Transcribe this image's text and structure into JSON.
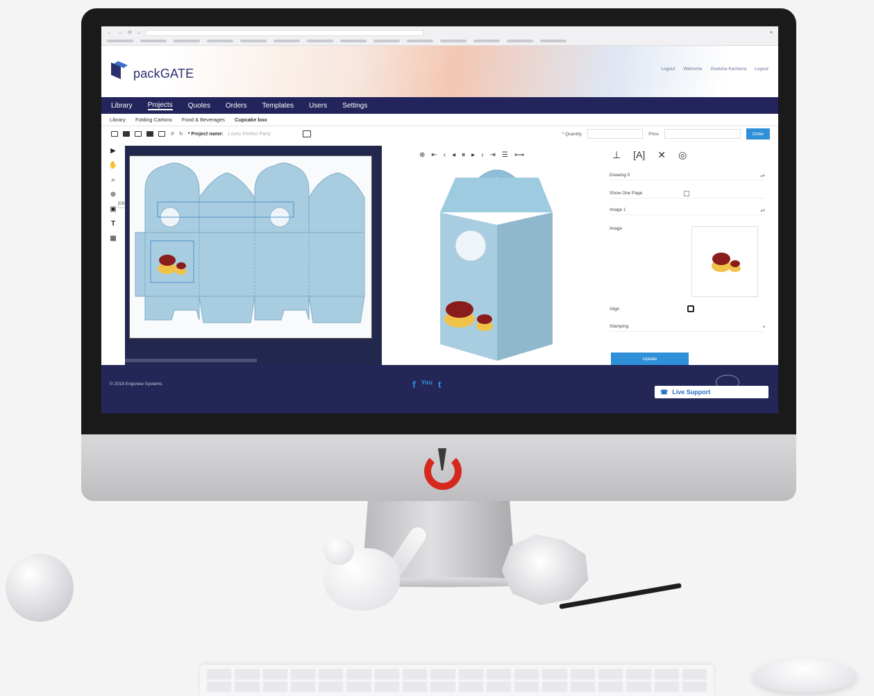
{
  "app": {
    "logo_text": "packGATE",
    "header_right": [
      "Logout",
      "Welcome",
      "Goelsha Kacheria",
      "Logout"
    ]
  },
  "nav": {
    "items": [
      {
        "label": "Library",
        "active": false
      },
      {
        "label": "Projects",
        "active": true
      },
      {
        "label": "Quotes",
        "active": false
      },
      {
        "label": "Orders",
        "active": false
      },
      {
        "label": "Templates",
        "active": false
      },
      {
        "label": "Users",
        "active": false
      },
      {
        "label": "Settings",
        "active": false
      }
    ]
  },
  "breadcrumb": [
    "Library",
    "Folding Cartons",
    "Food & Beverages",
    "Cupcake box"
  ],
  "toolbar": {
    "project_name_label": "* Project name:",
    "project_name_value": "Lovey Perfect Party",
    "quantity_label": "* Quantity",
    "price_label": "Price",
    "order_label": "Order"
  },
  "tool_tip": "Edit Image",
  "props": {
    "rows": [
      {
        "label": "Drawing 0",
        "value": "▴▾"
      },
      {
        "label": "Show One Page",
        "value": ""
      },
      {
        "label": "Image 1",
        "value": "▴▾"
      },
      {
        "label": "Image",
        "value": ""
      },
      {
        "label": "Align",
        "value": ""
      },
      {
        "label": "Stamping",
        "value": "▾"
      }
    ],
    "update_label": "Update"
  },
  "footer": {
    "copyright": "© 2018 Engiview Systems",
    "social": [
      "f",
      "You",
      "t"
    ],
    "live_support": "Live Support"
  },
  "colors": {
    "nav_bg": "#23245b",
    "accent": "#2f8fd8",
    "box_blue": "#a9cde0",
    "power_red": "#d6281f"
  }
}
